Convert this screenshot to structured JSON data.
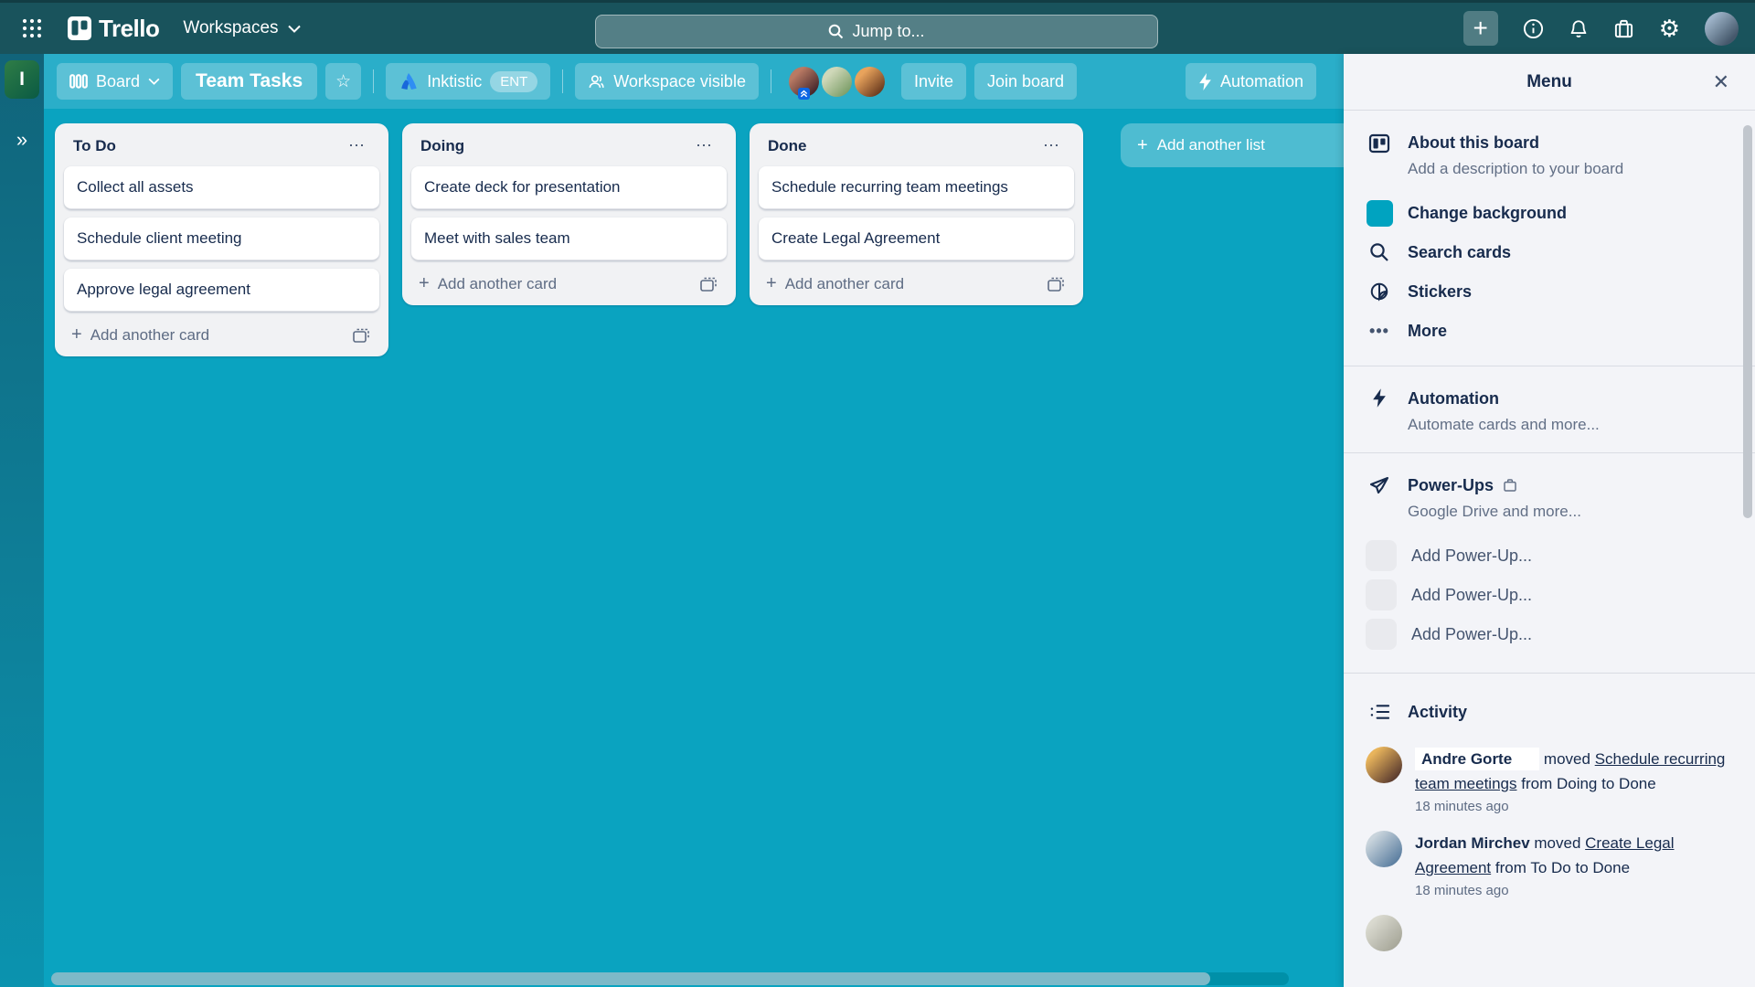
{
  "colors": {
    "nav_teal": "#19535c",
    "header_teal": "#2aaec9",
    "board_teal": "#0aa3c0",
    "accent_teal": "#00a3c0",
    "text_navy": "#172b4d",
    "text_gray": "#5e6c84"
  },
  "icons": {
    "plus": "+",
    "ellipsis": "⋯",
    "more_dots": "•••",
    "close": "✕",
    "star": "☆",
    "gear": "⚙",
    "collapse_chevrons": "»"
  },
  "topnav": {
    "brand": "Trello",
    "workspaces_label": "Workspaces",
    "search_placeholder": "Jump to..."
  },
  "rail": {
    "workspace_initial": "I"
  },
  "header": {
    "view_label": "Board",
    "title": "Team Tasks",
    "org_name": "Inktistic",
    "org_badge": "ENT",
    "visibility_label": "Workspace visible",
    "invite_label": "Invite",
    "join_label": "Join board",
    "automation_label": "Automation"
  },
  "board": {
    "lists": [
      {
        "title": "To Do",
        "cards": [
          "Collect all assets",
          "Schedule client meeting",
          "Approve legal agreement"
        ],
        "add_card_label": "Add another card"
      },
      {
        "title": "Doing",
        "cards": [
          "Create deck for presentation",
          "Meet with sales team"
        ],
        "add_card_label": "Add another card"
      },
      {
        "title": "Done",
        "cards": [
          "Schedule recurring team meetings",
          "Create Legal Agreement"
        ],
        "add_card_label": "Add another card"
      }
    ],
    "add_list_label": "Add another list"
  },
  "menu": {
    "title": "Menu",
    "about": {
      "label": "About this board",
      "sub": "Add a description to your board"
    },
    "change_background": {
      "label": "Change background"
    },
    "search_cards": {
      "label": "Search cards"
    },
    "stickers": {
      "label": "Stickers"
    },
    "more": {
      "label": "More"
    },
    "automation": {
      "label": "Automation",
      "sub": "Automate cards and more..."
    },
    "powerups": {
      "label": "Power-Ups",
      "sub": "Google Drive and more..."
    },
    "add_powerup_label": "Add Power-Up...",
    "activity": {
      "label": "Activity",
      "entries": [
        {
          "actor": "Andre Gorte",
          "action": "moved",
          "card": "Schedule recurring team meetings",
          "from_label": "from",
          "from": "Doing",
          "to_label": "to",
          "to": "Done",
          "time": "18 minutes ago"
        },
        {
          "actor": "Jordan Mirchev",
          "action": "moved",
          "card": "Create Legal Agreement",
          "from_label": "from",
          "from": "To Do",
          "to_label": "to",
          "to": "Done",
          "time": "18 minutes ago"
        }
      ]
    }
  }
}
